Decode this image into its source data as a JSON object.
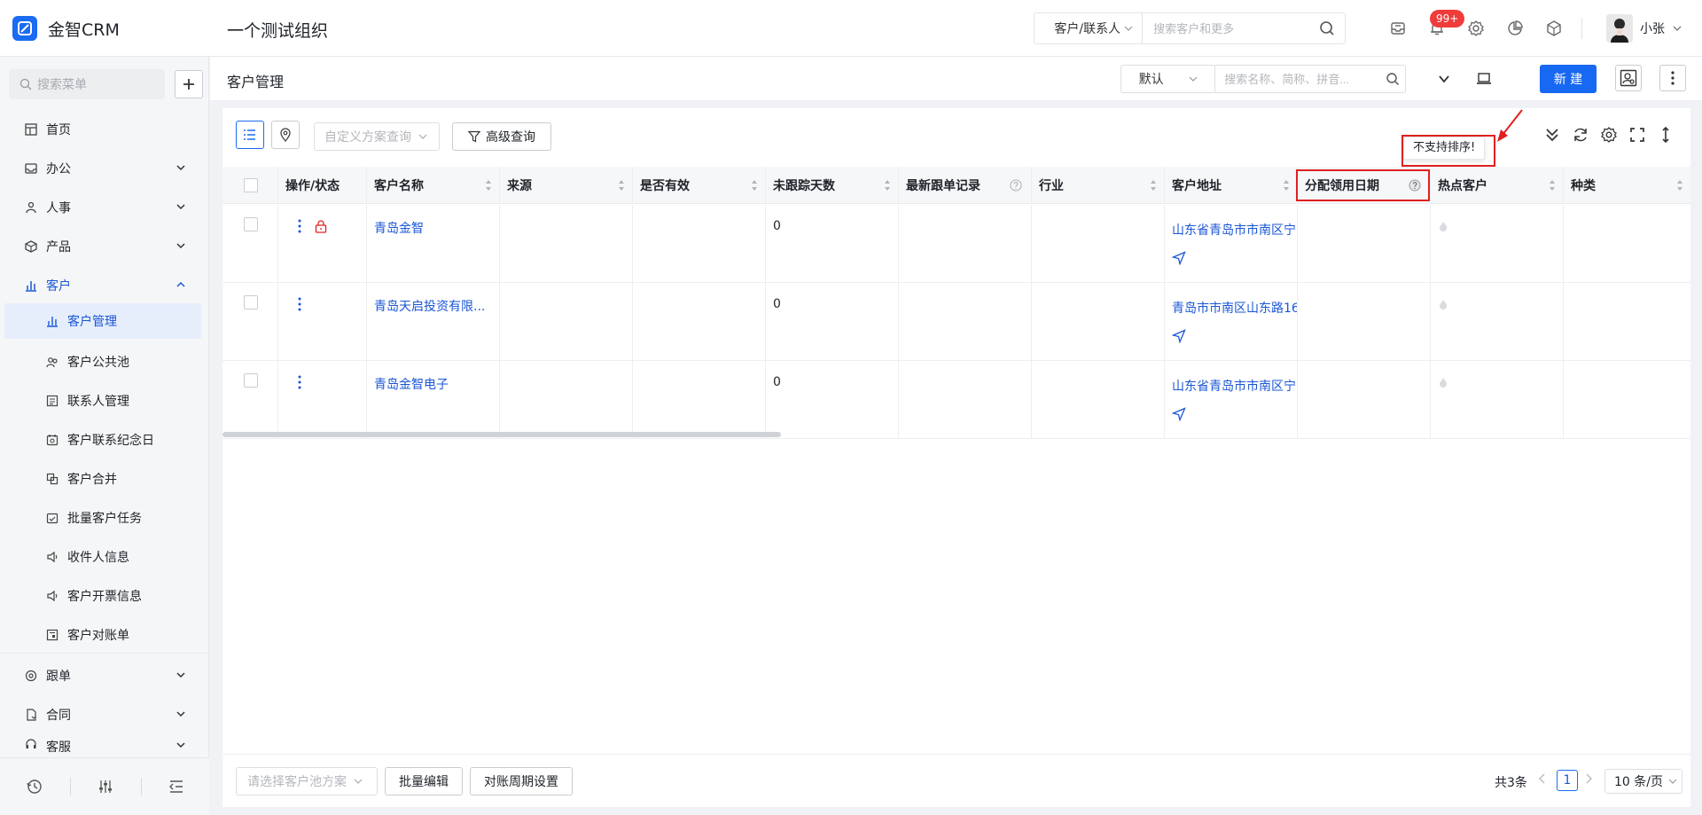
{
  "app": {
    "name": "金智CRM",
    "org": "一个测试组织"
  },
  "header": {
    "search_scope": "客户/联系人",
    "search_placeholder": "搜索客户和更多",
    "notif_badge": "99+",
    "user_name": "小张"
  },
  "sidebar": {
    "search_placeholder": "搜索菜单",
    "items": [
      {
        "label": "首页"
      },
      {
        "label": "办公"
      },
      {
        "label": "人事"
      },
      {
        "label": "产品"
      },
      {
        "label": "客户"
      },
      {
        "label": "客户管理"
      },
      {
        "label": "客户公共池"
      },
      {
        "label": "联系人管理"
      },
      {
        "label": "客户联系纪念日"
      },
      {
        "label": "客户合并"
      },
      {
        "label": "批量客户任务"
      },
      {
        "label": "收件人信息"
      },
      {
        "label": "客户开票信息"
      },
      {
        "label": "客户对账单"
      },
      {
        "label": "跟单"
      },
      {
        "label": "合同"
      },
      {
        "label": "客服"
      }
    ]
  },
  "page": {
    "title": "客户管理",
    "view_select": "默认",
    "search_placeholder": "搜索名称、简称、拼音...",
    "new_button": "新 建"
  },
  "toolbar": {
    "scheme_placeholder": "自定义方案查询",
    "advanced_query": "高级查询",
    "tooltip": "不支持排序!"
  },
  "table": {
    "columns": [
      "操作/状态",
      "客户名称",
      "来源",
      "是否有效",
      "未跟踪天数",
      "最新跟单记录",
      "行业",
      "客户地址",
      "分配领用日期",
      "热点客户",
      "种类"
    ],
    "rows": [
      {
        "name": "青岛金智",
        "days": "0",
        "address": "山东省青岛市市南区宁"
      },
      {
        "name": "青岛天启投资有限...",
        "days": "0",
        "address": "青岛市市南区山东路16"
      },
      {
        "name": "青岛金智电子",
        "days": "0",
        "address": "山东省青岛市市南区宁"
      }
    ]
  },
  "footer": {
    "pool_placeholder": "请选择客户池方案",
    "batch_edit": "批量编辑",
    "period_settings": "对账周期设置",
    "total": "共3条",
    "current_page": "1",
    "page_size": "10 条/页"
  },
  "colors": {
    "primary": "#1768f2",
    "link": "#1a56d6",
    "alert_red": "#e02020",
    "badge_red": "#f03b3b"
  }
}
